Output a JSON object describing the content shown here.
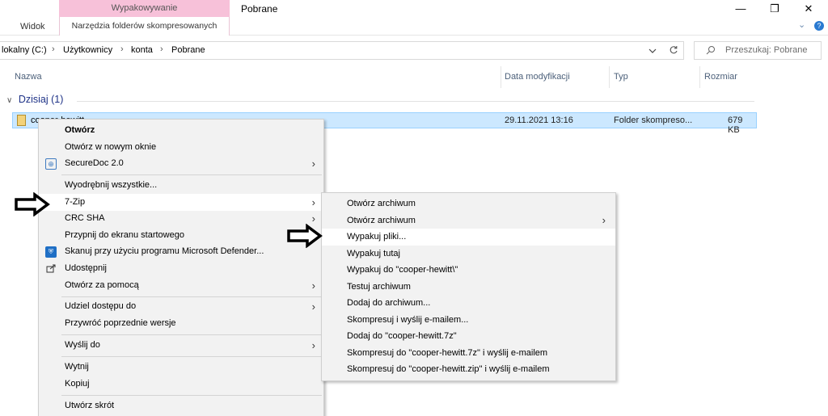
{
  "ribbon": {
    "tab_view": "Widok",
    "context_group": "Wypakowywanie",
    "context_tab": "Narzędzia folderów skompresowanych",
    "window_title": "Pobrane"
  },
  "window_controls": {
    "minimize": "—",
    "restore": "❐",
    "close": "✕",
    "expand": "⌄",
    "help": "?"
  },
  "address": {
    "crumbs": [
      "lokalny (C:)",
      "Użytkownicy",
      "konta",
      "Pobrane"
    ],
    "separator": "›",
    "dropdown_icon": "chevron-down-icon",
    "refresh_icon": "refresh-icon"
  },
  "search": {
    "placeholder": "Przeszukaj: Pobrane",
    "icon": "search-icon"
  },
  "columns": {
    "name": "Nazwa",
    "date": "Data modyfikacji",
    "type": "Typ",
    "size": "Rozmiar"
  },
  "group": {
    "label": "Dzisiaj (1)"
  },
  "file": {
    "name": "cooper-hewitt",
    "date": "29.11.2021 13:16",
    "type": "Folder skompreso...",
    "size": "679 KB"
  },
  "context_menu": {
    "items": [
      {
        "label": "Otwórz"
      },
      {
        "label": "Otwórz w nowym oknie"
      },
      {
        "label": "SecureDoc 2.0"
      },
      {
        "label": "Wyodrębnij wszystkie..."
      },
      {
        "label": "7-Zip"
      },
      {
        "label": "CRC SHA"
      },
      {
        "label": "Przypnij do ekranu startowego"
      },
      {
        "label": "Skanuj przy użyciu programu Microsoft Defender..."
      },
      {
        "label": "Udostępnij"
      },
      {
        "label": "Otwórz za pomocą"
      },
      {
        "label": "Udziel dostępu do"
      },
      {
        "label": "Przywróć poprzednie wersje"
      },
      {
        "label": "Wyślij do"
      },
      {
        "label": "Wytnij"
      },
      {
        "label": "Kopiuj"
      },
      {
        "label": "Utwórz skrót"
      }
    ]
  },
  "submenu": {
    "items": [
      {
        "label": "Otwórz archiwum"
      },
      {
        "label": "Otwórz archiwum"
      },
      {
        "label": "Wypakuj pliki..."
      },
      {
        "label": "Wypakuj tutaj"
      },
      {
        "label": "Wypakuj do \"cooper-hewitt\\\""
      },
      {
        "label": "Testuj archiwum"
      },
      {
        "label": "Dodaj do archiwum..."
      },
      {
        "label": "Skompresuj i wyślij e-mailem..."
      },
      {
        "label": "Dodaj do \"cooper-hewitt.7z\""
      },
      {
        "label": "Skompresuj do \"cooper-hewitt.7z\" i wyślij e-mailem"
      },
      {
        "label": "Skompresuj do \"cooper-hewitt.zip\" i wyślij e-mailem"
      }
    ]
  },
  "colors": {
    "selection": "#cce8ff",
    "context_group": "#f7c1d9",
    "group_header": "#1e3287"
  }
}
